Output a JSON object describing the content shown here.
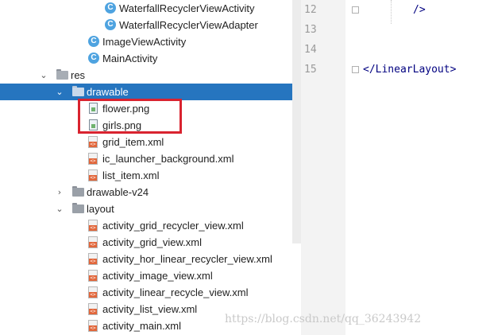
{
  "tree": {
    "items": [
      {
        "label": "WaterfallRecyclerViewActivity",
        "icon": "class-icon"
      },
      {
        "label": "WaterfallRecyclerViewAdapter",
        "icon": "class-icon"
      },
      {
        "label": "ImageViewActivity",
        "icon": "class-icon"
      },
      {
        "label": "MainActivity",
        "icon": "class-icon"
      },
      {
        "label": "res",
        "icon": "res-folder-icon",
        "expanded": true
      },
      {
        "label": "drawable",
        "icon": "folder-icon",
        "expanded": true,
        "selected": true
      },
      {
        "label": "flower.png",
        "icon": "png-file-icon"
      },
      {
        "label": "girls.png",
        "icon": "png-file-icon"
      },
      {
        "label": "grid_item.xml",
        "icon": "xml-file-icon"
      },
      {
        "label": "ic_launcher_background.xml",
        "icon": "xml-file-icon"
      },
      {
        "label": "list_item.xml",
        "icon": "xml-file-icon"
      },
      {
        "label": "drawable-v24",
        "icon": "folder-icon",
        "expanded": false
      },
      {
        "label": "layout",
        "icon": "folder-icon",
        "expanded": true
      },
      {
        "label": "activity_grid_recycler_view.xml",
        "icon": "xml-file-icon"
      },
      {
        "label": "activity_grid_view.xml",
        "icon": "xml-file-icon"
      },
      {
        "label": "activity_hor_linear_recycler_view.xml",
        "icon": "xml-file-icon"
      },
      {
        "label": "activity_image_view.xml",
        "icon": "xml-file-icon"
      },
      {
        "label": "activity_linear_recycle_view.xml",
        "icon": "xml-file-icon"
      },
      {
        "label": "activity_list_view.xml",
        "icon": "xml-file-icon"
      },
      {
        "label": "activity_main.xml",
        "icon": "xml-file-icon"
      }
    ],
    "class_icon_letter": "C",
    "highlight_color": "#d9232f",
    "selection_color": "#2675bf"
  },
  "editor": {
    "lines": [
      {
        "number": "12",
        "code": "/>"
      },
      {
        "number": "13",
        "code": ""
      },
      {
        "number": "14",
        "code": ""
      },
      {
        "number": "15",
        "code": "</LinearLayout>"
      }
    ]
  },
  "watermark": "https://blog.csdn.net/qq_36243942"
}
